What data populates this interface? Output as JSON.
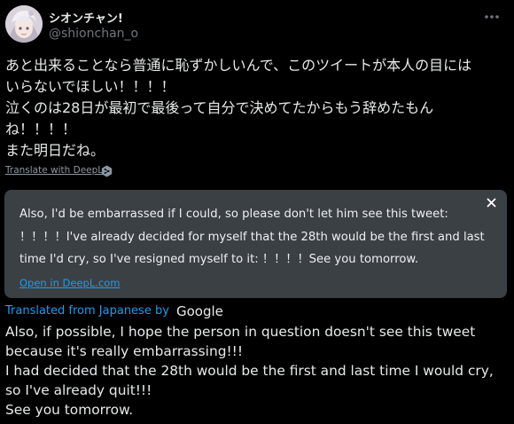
{
  "author": {
    "display_name": "シオンチャン!",
    "handle": "@shionchan_o"
  },
  "more_icon": "more-horizontal-icon",
  "tweet": {
    "lines": [
      "あと出来ることなら普通に恥ずかしいんで、このツイートが本人の目には",
      "いらないでほしい！！！！",
      "泣くのは28日が最初で最後って自分で決めてたからもう辞めたもん",
      "ね！！！！",
      "また明日だね。"
    ],
    "translate_link": "Translate with DeepL"
  },
  "deepl": {
    "lines": [
      "Also, I'd be embarrassed if I could, so please don't let him see this tweet:",
      "！！！！I've already decided for myself that the 28th would be the first and last",
      "time I'd cry, so I've resigned myself to it: ！！！！See you tomorrow."
    ],
    "open_link": "Open in DeepL.com",
    "close_icon": "close-icon"
  },
  "translation": {
    "translated_from": "Translated from Japanese by",
    "provider": "Google",
    "lines": [
      "Also, if possible, I hope the person in question doesn't see this tweet",
      "because it's really embarrassing!!!",
      "I had decided that the 28th would be the first and last time I would cry,",
      "so I've already quit!!!",
      "See you tomorrow."
    ]
  },
  "colors": {
    "background": "#000000",
    "text": "#e7e9ea",
    "secondary": "#71767b",
    "link": "#1d9bf0",
    "deepl_box": "#3b4045"
  }
}
